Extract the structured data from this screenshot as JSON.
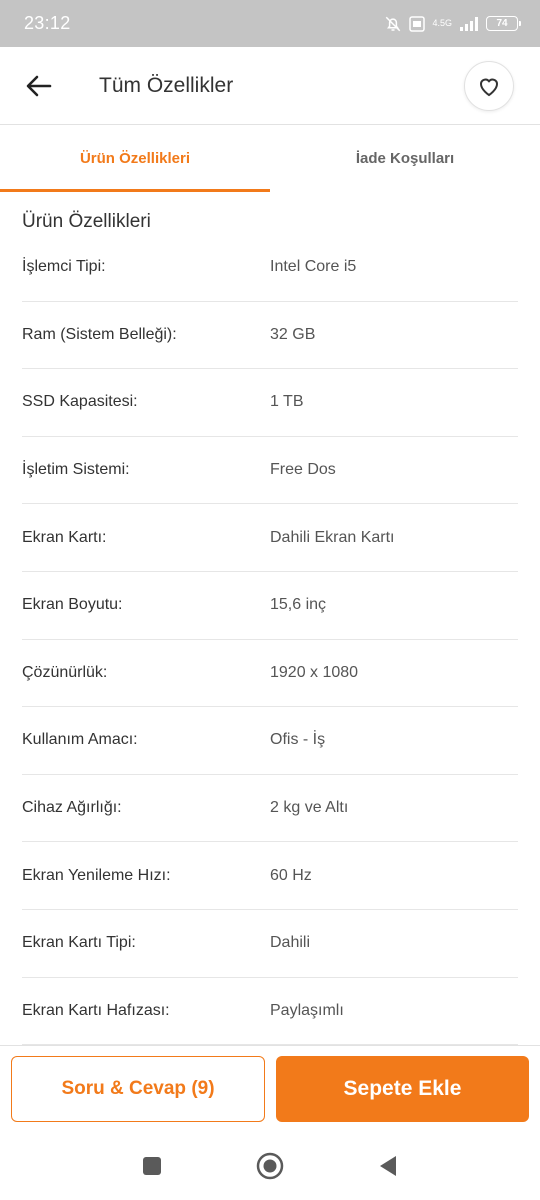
{
  "status_bar": {
    "time": "23:12",
    "network_label": "4.5G",
    "battery": "74",
    "icons": [
      "mute-bell-icon",
      "volte-icon",
      "signal-icon",
      "battery-icon"
    ]
  },
  "header": {
    "title": "Tüm Özellikler",
    "back_icon": "arrow-left-icon",
    "favorite_icon": "heart-outline-icon"
  },
  "tabs": [
    {
      "label": "Ürün Özellikleri",
      "active": true
    },
    {
      "label": "İade Koşulları",
      "active": false
    }
  ],
  "section": {
    "title": "Ürün Özellikleri",
    "specs": [
      {
        "label": "İşlemci Tipi:",
        "value": "Intel Core i5"
      },
      {
        "label": "Ram (Sistem Belleği):",
        "value": "32 GB"
      },
      {
        "label": "SSD Kapasitesi:",
        "value": "1 TB"
      },
      {
        "label": "İşletim Sistemi:",
        "value": "Free Dos"
      },
      {
        "label": "Ekran Kartı:",
        "value": "Dahili Ekran Kartı"
      },
      {
        "label": "Ekran Boyutu:",
        "value": "15,6 inç"
      },
      {
        "label": "Çözünürlük:",
        "value": "1920 x 1080"
      },
      {
        "label": "Kullanım Amacı:",
        "value": "Ofis - İş"
      },
      {
        "label": "Cihaz Ağırlığı:",
        "value": "2 kg ve Altı"
      },
      {
        "label": "Ekran Yenileme Hızı:",
        "value": "60 Hz"
      },
      {
        "label": "Ekran Kartı Tipi:",
        "value": "Dahili"
      },
      {
        "label": "Ekran Kartı Hafızası:",
        "value": "Paylaşımlı"
      }
    ]
  },
  "bottom_bar": {
    "qa_label": "Soru & Cevap (9)",
    "cart_label": "Sepete Ekle"
  },
  "colors": {
    "accent": "#f27a1a",
    "status_bar_bg": "#c4c4c4"
  },
  "nav_bar": {
    "icons": [
      "recent-apps-square-icon",
      "home-circle-icon",
      "back-triangle-icon"
    ]
  }
}
